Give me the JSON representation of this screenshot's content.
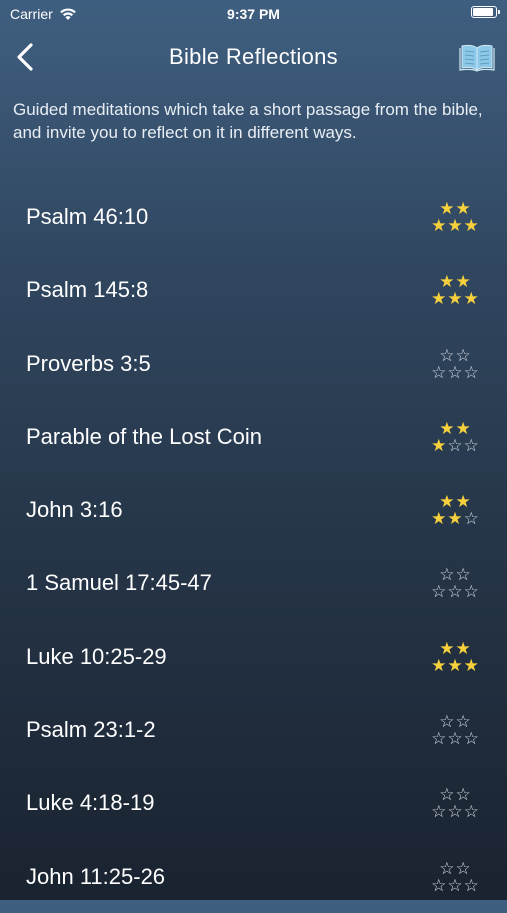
{
  "status": {
    "carrier": "Carrier",
    "time": "9:37 PM",
    "battery_level": 0.95
  },
  "nav": {
    "title": "Bible Reflections",
    "back_icon": "chevron-left-icon",
    "book_icon": "open-book-icon"
  },
  "description": "Guided meditations which take a short passage from the bible, and invite you to reflect on it in different ways.",
  "colors": {
    "star_filled": "#f7d13c",
    "star_empty": "#d7dde4",
    "book_icon": "#8ec8e8"
  },
  "items": [
    {
      "title": "Psalm 46:10",
      "stars": 5
    },
    {
      "title": "Psalm 145:8",
      "stars": 5
    },
    {
      "title": "Proverbs 3:5",
      "stars": 0
    },
    {
      "title": "Parable of the Lost Coin",
      "stars": 3
    },
    {
      "title": "John 3:16",
      "stars": 4
    },
    {
      "title": "1 Samuel 17:45-47",
      "stars": 0
    },
    {
      "title": "Luke 10:25-29",
      "stars": 5
    },
    {
      "title": "Psalm 23:1-2",
      "stars": 0
    },
    {
      "title": "Luke 4:18-19",
      "stars": 0
    },
    {
      "title": "John 11:25-26",
      "stars": 0
    }
  ]
}
